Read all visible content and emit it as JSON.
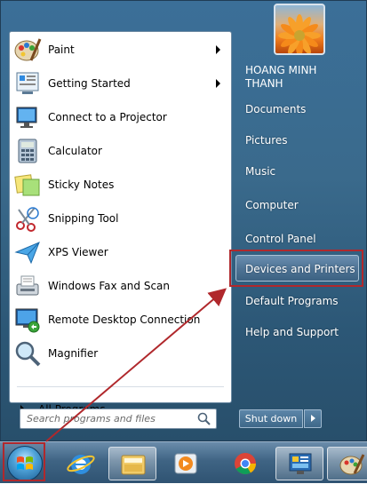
{
  "programs": [
    {
      "label": "Paint",
      "icon": "paint-icon",
      "has_submenu": true
    },
    {
      "label": "Getting Started",
      "icon": "getting-started-icon",
      "has_submenu": true
    },
    {
      "label": "Connect to a Projector",
      "icon": "projector-icon",
      "has_submenu": false
    },
    {
      "label": "Calculator",
      "icon": "calculator-icon",
      "has_submenu": false
    },
    {
      "label": "Sticky Notes",
      "icon": "sticky-notes-icon",
      "has_submenu": false
    },
    {
      "label": "Snipping Tool",
      "icon": "snipping-tool-icon",
      "has_submenu": false
    },
    {
      "label": "XPS Viewer",
      "icon": "xps-viewer-icon",
      "has_submenu": false
    },
    {
      "label": "Windows Fax and Scan",
      "icon": "fax-scan-icon",
      "has_submenu": false
    },
    {
      "label": "Remote Desktop Connection",
      "icon": "remote-desktop-icon",
      "has_submenu": false
    },
    {
      "label": "Magnifier",
      "icon": "magnifier-icon",
      "has_submenu": false
    }
  ],
  "all_programs": "All Programs",
  "search": {
    "placeholder": "Search programs and files"
  },
  "user": {
    "line1": "HOANG MINH",
    "line2": "THANH"
  },
  "right_links": [
    {
      "label": "Documents"
    },
    {
      "label": "Pictures"
    },
    {
      "label": "Music"
    },
    {
      "label": "Computer"
    },
    {
      "label": "Control Panel"
    },
    {
      "label": "Devices and Printers",
      "highlighted": true
    },
    {
      "label": "Default Programs"
    },
    {
      "label": "Help and Support"
    }
  ],
  "shutdown": {
    "label": "Shut down"
  },
  "taskbar": [
    "start-orb",
    "internet-explorer-icon",
    "windows-explorer-icon",
    "media-player-icon",
    "chrome-icon",
    "control-panel-icon",
    "paint-icon"
  ],
  "colors": {
    "annotation_red": "#b0282c",
    "menu_blue": "#3a6a8c"
  }
}
